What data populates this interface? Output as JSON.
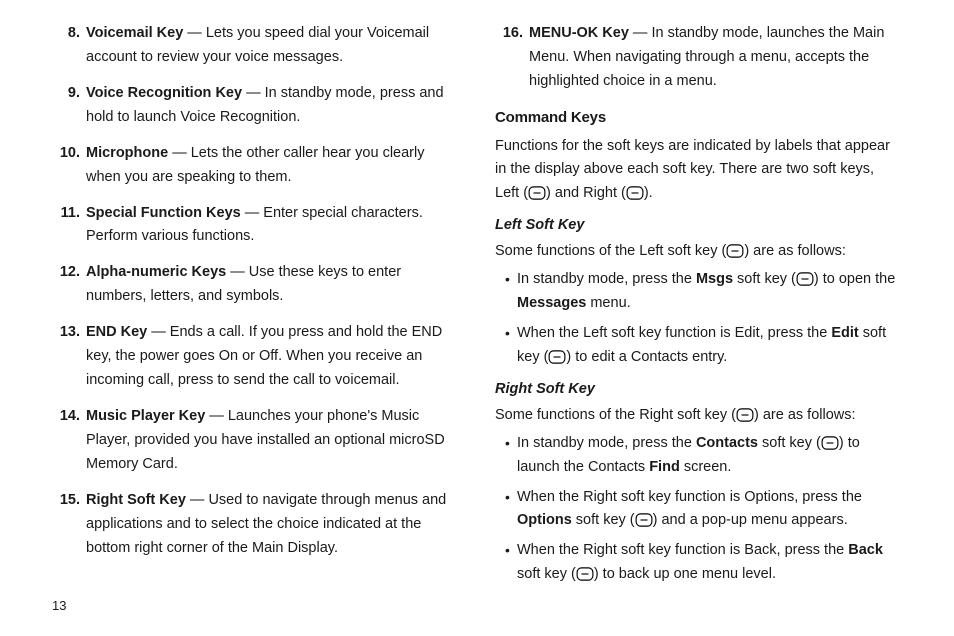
{
  "page_number": "13",
  "list_left": [
    {
      "n": "8.",
      "term": "Voicemail Key",
      "desc": " — Lets you speed dial your Voicemail account to review your voice messages."
    },
    {
      "n": "9.",
      "term": "Voice Recognition Key",
      "desc": " — In standby mode, press and hold to launch Voice Recognition."
    },
    {
      "n": "10.",
      "term": "Microphone",
      "desc": " — Lets the other caller hear you clearly when you are speaking to them."
    },
    {
      "n": "11.",
      "term": "Special Function Keys",
      "desc": " — Enter special characters. Perform various functions."
    },
    {
      "n": "12.",
      "term": "Alpha-numeric Keys",
      "desc": " — Use these keys to enter numbers, letters, and symbols."
    },
    {
      "n": "13.",
      "term": "END Key",
      "desc": " — Ends a call. If you press and hold the END key, the power goes On or Off. When you receive an incoming call, press to send the call to voicemail."
    },
    {
      "n": "14.",
      "term": "Music Player Key",
      "desc": " — Launches your phone's Music Player, provided you have installed an optional microSD Memory Card."
    },
    {
      "n": "15.",
      "term": "Right Soft Key",
      "desc": " — Used to navigate through menus and applications and to select the choice indicated at the bottom right corner of the Main Display."
    }
  ],
  "list_right": [
    {
      "n": "16.",
      "term": "MENU-OK Key",
      "desc": " — In standby mode, launches the Main Menu. When navigating through a menu, accepts the highlighted choice in a menu."
    }
  ],
  "cmd_heading": "Command Keys",
  "cmd_para_a": "Functions for the soft keys are indicated by labels that appear in the display above each soft key. There are two soft keys, Left (",
  "cmd_para_b": ") and Right (",
  "cmd_para_c": ").",
  "lsk_heading": "Left Soft Key",
  "lsk_intro_a": "Some functions of the Left soft key (",
  "lsk_intro_b": ") are as follows:",
  "lsk_b1_a": "In standby mode, press the ",
  "lsk_b1_bold1": "Msgs",
  "lsk_b1_b": " soft key (",
  "lsk_b1_c": ") to open the ",
  "lsk_b1_bold2": "Messages",
  "lsk_b1_d": " menu.",
  "lsk_b2_a": "When the Left soft key function is Edit, press the ",
  "lsk_b2_bold": "Edit",
  "lsk_b2_b": " soft key (",
  "lsk_b2_c": ") to edit a Contacts entry.",
  "rsk_heading": "Right Soft Key",
  "rsk_intro_a": "Some functions of the Right soft key (",
  "rsk_intro_b": ") are as follows:",
  "rsk_b1_a": "In standby mode, press the ",
  "rsk_b1_bold1": "Contacts",
  "rsk_b1_b": " soft key (",
  "rsk_b1_c": ") to launch the Contacts ",
  "rsk_b1_bold2": "Find",
  "rsk_b1_d": " screen.",
  "rsk_b2_a": "When the Right soft key function is Options, press the ",
  "rsk_b2_bold": "Options",
  "rsk_b2_b": " soft key (",
  "rsk_b2_c": ") and a pop-up menu appears.",
  "rsk_b3_a": "When the Right soft key function is Back, press the ",
  "rsk_b3_bold": "Back",
  "rsk_b3_b": " soft key (",
  "rsk_b3_c": ") to back up one menu level."
}
